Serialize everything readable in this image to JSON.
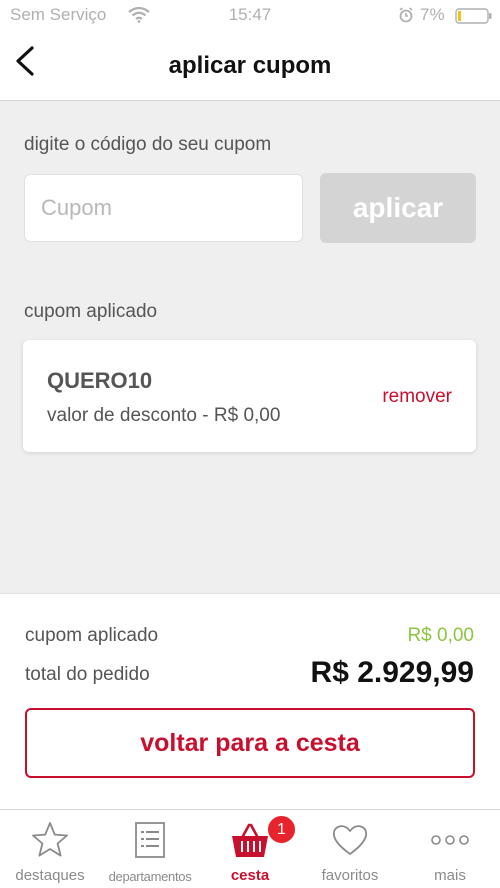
{
  "status_bar": {
    "carrier": "Sem Serviço",
    "time": "15:47",
    "battery": "7%"
  },
  "header": {
    "title": "aplicar cupom"
  },
  "coupon_form": {
    "prompt": "digite o código do seu cupom",
    "input_value": "",
    "input_placeholder": "Cupom",
    "apply_label": "aplicar"
  },
  "applied_coupon": {
    "heading": "cupom aplicado",
    "code": "QUERO10",
    "discount_text": "valor de desconto - R$ 0,00",
    "remove_label": "remover"
  },
  "summary": {
    "coupon_label": "cupom aplicado",
    "coupon_value": "R$ 0,00",
    "total_label": "total do pedido",
    "total_value": "R$ 2.929,99",
    "back_label": "voltar para a cesta"
  },
  "tab_bar": {
    "tabs": [
      {
        "label": "destaques",
        "icon": "star-icon"
      },
      {
        "label": "departamentos",
        "icon": "list-icon"
      },
      {
        "label": "cesta",
        "icon": "basket-icon",
        "active": true
      },
      {
        "label": "favoritos",
        "icon": "heart-icon"
      },
      {
        "label": "mais",
        "icon": "more-icon"
      }
    ],
    "cart_badge": "1"
  },
  "colors": {
    "accent_red": "#c8102e",
    "discount_green": "#8cc63f",
    "apply_disabled": "#d4d4d4"
  }
}
